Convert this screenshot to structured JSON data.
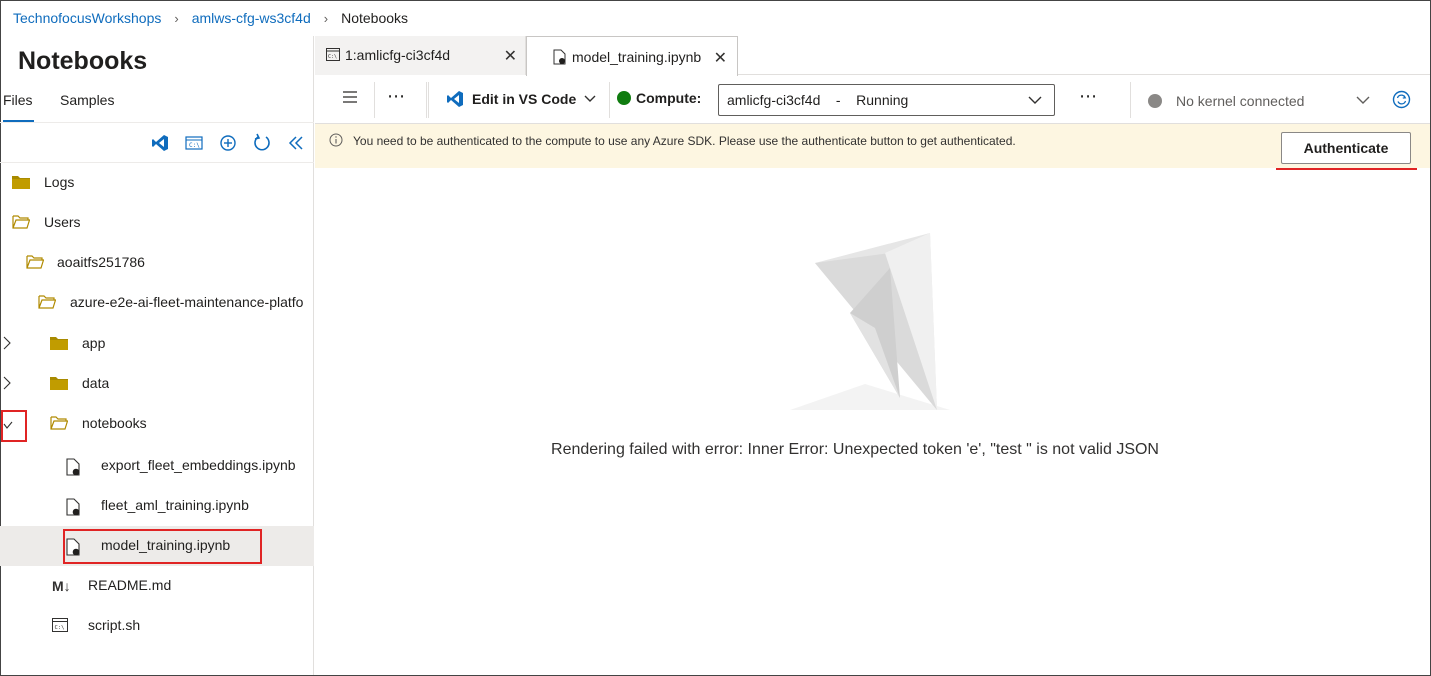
{
  "breadcrumb": {
    "items": [
      "TechnofocusWorkshops",
      "amlws-cfg-ws3cf4d",
      "Notebooks"
    ]
  },
  "left_panel": {
    "title": "Notebooks",
    "tabs": [
      "Files",
      "Samples"
    ],
    "toolbar_icons": [
      "vscode-icon",
      "terminal-icon",
      "add-icon",
      "refresh-icon",
      "collapse-icon"
    ],
    "tree": [
      {
        "label": "Logs",
        "icon": "folder-closed"
      },
      {
        "label": "Users",
        "icon": "folder-open"
      },
      {
        "label": "aoaitfs251786",
        "icon": "folder-open"
      },
      {
        "label": "azure-e2e-ai-fleet-maintenance-platfo",
        "icon": "folder-open"
      },
      {
        "label": "app",
        "icon": "folder-closed",
        "chevron": "collapsed"
      },
      {
        "label": "data",
        "icon": "folder-closed",
        "chevron": "collapsed"
      },
      {
        "label": "notebooks",
        "icon": "folder-open",
        "chevron": "expanded"
      },
      {
        "label": "export_fleet_embeddings.ipynb",
        "icon": "notebook-file"
      },
      {
        "label": "fleet_aml_training.ipynb",
        "icon": "notebook-file"
      },
      {
        "label": "model_training.ipynb",
        "icon": "notebook-file",
        "selected": true
      },
      {
        "label": "README.md",
        "icon": "markdown-file"
      },
      {
        "label": "script.sh",
        "icon": "terminal-file"
      }
    ]
  },
  "tabs": [
    {
      "label": "1:amlicfg-ci3cf4d"
    },
    {
      "label": "model_training.ipynb"
    }
  ],
  "command_bar": {
    "edit_vscode": "Edit in VS Code",
    "compute_label": "Compute:",
    "compute_value": "amlicfg-ci3cf4d    -    Running",
    "kernel_value": "No kernel connected",
    "compute_status_color": "#107c10"
  },
  "banner": {
    "message": "You need to be authenticated to the compute to use any Azure SDK. Please use the authenticate button to get authenticated.",
    "button": "Authenticate"
  },
  "main": {
    "error": "Rendering failed with error: Inner Error: Unexpected token 'e', \"test \" is not valid JSON"
  }
}
